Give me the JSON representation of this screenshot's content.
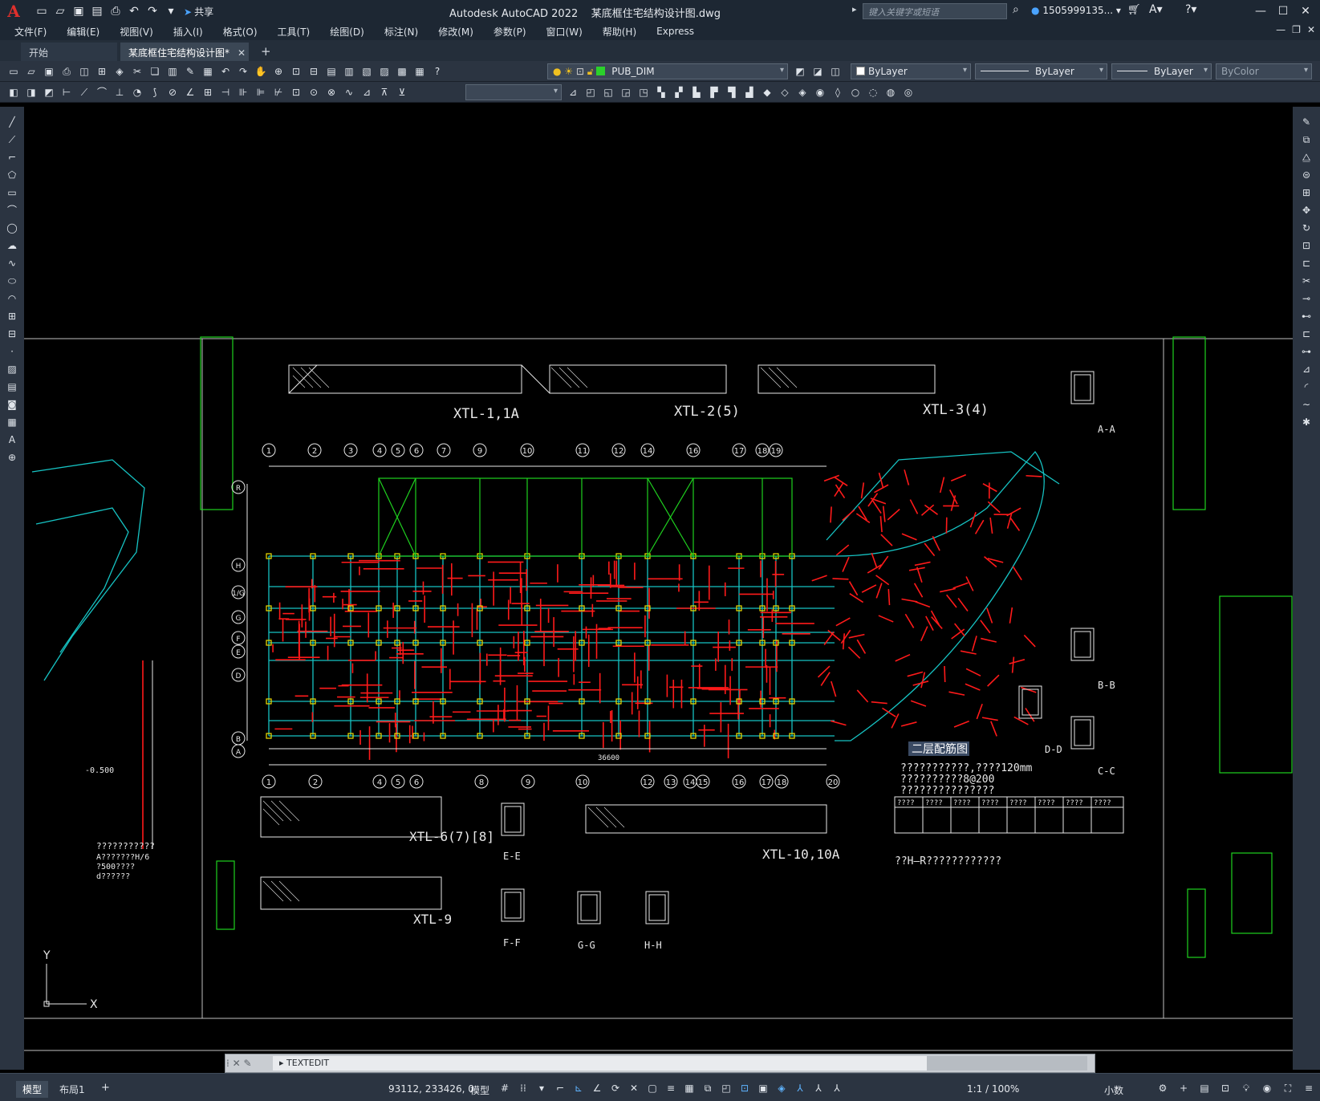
{
  "app": {
    "logo": "A",
    "title": "Autodesk AutoCAD 2022",
    "filename": "某底框住宅结构设计图.dwg",
    "search_placeholder": "键入关键字或短语",
    "user": "1505999135...",
    "share_label": "共享"
  },
  "menu": [
    "文件(F)",
    "编辑(E)",
    "视图(V)",
    "插入(I)",
    "格式(O)",
    "工具(T)",
    "绘图(D)",
    "标注(N)",
    "修改(M)",
    "参数(P)",
    "窗口(W)",
    "帮助(H)",
    "Express"
  ],
  "tabs": {
    "start": "开始",
    "active": "某底框住宅结构设计图*"
  },
  "layers": {
    "current_layer": "PUB_DIM",
    "color": "ByLayer",
    "linetype": "ByLayer",
    "lineweight": "ByLayer",
    "plotstyle": "ByColor",
    "layer_color": "#2bd12b"
  },
  "drawing": {
    "main_label": "二层配筋图",
    "note1": "???????????,????120mm",
    "note2": "??????????8@200",
    "note3": "???????????????",
    "note4": "??H—R????????????",
    "left_note1": "???????????",
    "left_note2": "A???????H/6",
    "left_note3": "?500????",
    "left_note4": "d??????",
    "left_level": "-0.500",
    "beam_labels": [
      "XTL-1,1A",
      "XTL-2(5)",
      "XTL-3(4)",
      "XTL-6(7)[8]",
      "XTL-10,10A",
      "XTL-9"
    ],
    "section_labels": [
      "A-A",
      "B-B",
      "C-C",
      "D-D",
      "E-E",
      "F-F",
      "G-G",
      "H-H"
    ],
    "axis_top": [
      "1",
      "2",
      "3",
      "4",
      "5",
      "6",
      "7",
      "9",
      "10",
      "11",
      "12",
      "14",
      "16",
      "17",
      "18",
      "19"
    ],
    "axis_bottom": [
      "1",
      "2",
      "4",
      "5",
      "6",
      "8",
      "9",
      "10",
      "12",
      "13",
      "14",
      "15",
      "16",
      "17",
      "18",
      "20"
    ],
    "axis_left": [
      "R",
      "H",
      "1/G",
      "G",
      "F",
      "E",
      "D",
      "B",
      "A"
    ],
    "overall_dim": "36600",
    "table_header": [
      "????",
      "????",
      "????",
      "????",
      "????",
      "????",
      "????",
      "????"
    ],
    "ucs_x": "X",
    "ucs_y": "Y"
  },
  "command": {
    "prompt": "TEXTEDIT"
  },
  "status": {
    "model_tab": "模型",
    "layout_tab": "布局1",
    "coords": "93112, 233426, 0",
    "space": "模型",
    "scale": "1:1 / 100%",
    "units": "小数"
  },
  "colors": {
    "titlebar": "#1d2733",
    "toolbar": "#2b3441",
    "cyan": "#16c3c3",
    "red": "#ff1a1a",
    "yellow": "#f0e000",
    "green": "#1fd11f",
    "white": "#e8e8e8"
  }
}
